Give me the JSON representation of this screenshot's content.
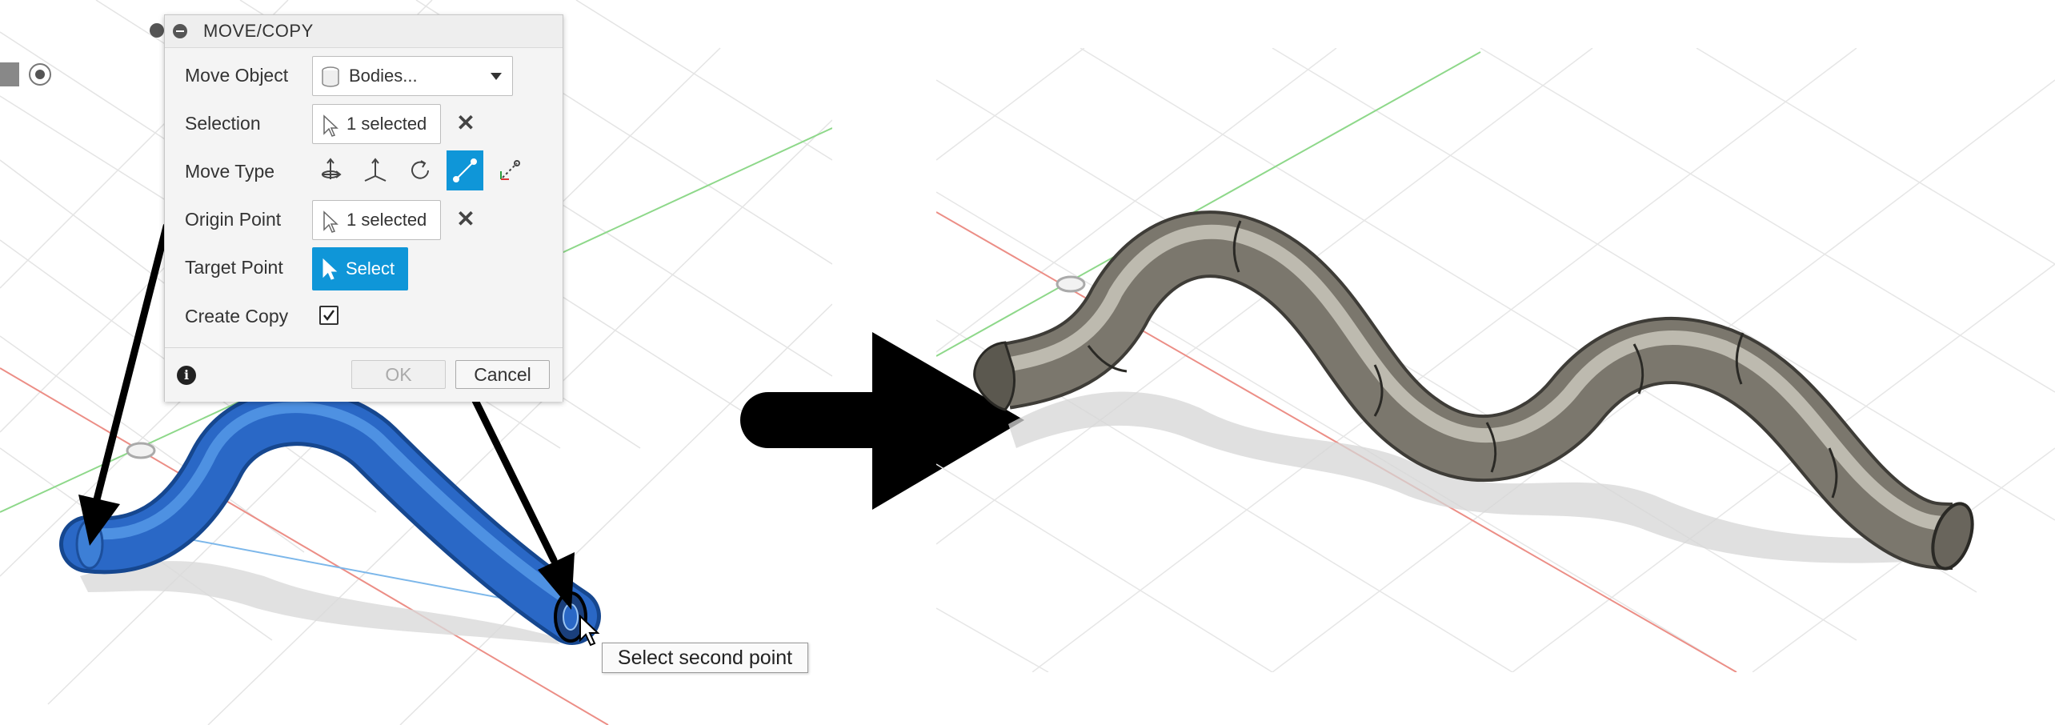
{
  "dialog": {
    "title": "MOVE/COPY",
    "move_object": {
      "label": "Move Object",
      "value": "Bodies..."
    },
    "selection": {
      "label": "Selection",
      "value": "1 selected"
    },
    "move_type": {
      "label": "Move Type",
      "options": [
        "free-move-icon",
        "translate-icon",
        "rotate-icon",
        "point-to-point-icon",
        "point-to-position-icon"
      ],
      "active": "point-to-point-icon"
    },
    "origin_point": {
      "label": "Origin Point",
      "value": "1 selected"
    },
    "target_point": {
      "label": "Target Point",
      "button": "Select"
    },
    "create_copy": {
      "label": "Create Copy",
      "checked": true
    },
    "ok_label": "OK",
    "cancel_label": "Cancel"
  },
  "tooltip": {
    "text": "Select second point"
  },
  "colors": {
    "accent": "#0f96d8",
    "tube_selected": "#2d6fca",
    "tube_result": "#7a766c",
    "grid": "#e3e3e3",
    "axis_red": "#e77b73",
    "axis_green": "#7fd37a"
  }
}
